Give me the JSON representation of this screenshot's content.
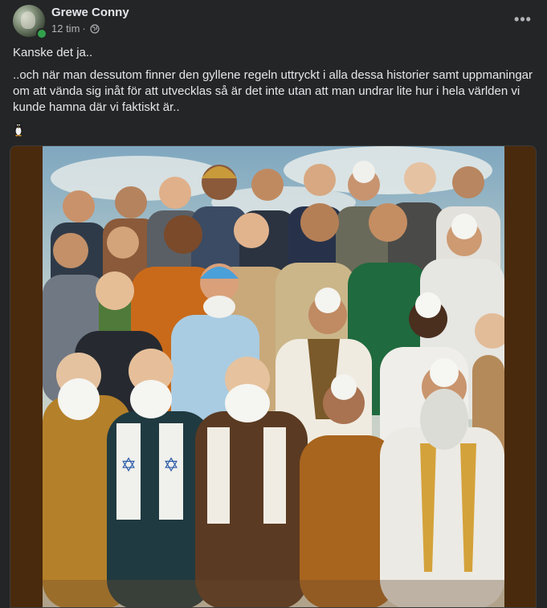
{
  "post": {
    "author": "Grewe Conny",
    "time": "12 tim",
    "separator": "·",
    "privacy_icon": "globe-icon",
    "more_icon": "more-options-icon",
    "more_label": "•••",
    "line1": "Kanske det ja..",
    "line2": "..och när man dessutom finner den gyllene regeln uttryckt i alla dessa historier samt uppmaningar om att vända sig inåt för att utvecklas så är det inte utan att man undrar lite hur i hela världen vi kunde hamna där vi faktiskt är..",
    "emoji_icon": "penguin-emoji"
  },
  "colors": {
    "background": "#242526",
    "text": "#e4e6eb",
    "secondary": "#b0b3b8",
    "online": "#31a24c",
    "image_border": "#4a2a0c"
  }
}
